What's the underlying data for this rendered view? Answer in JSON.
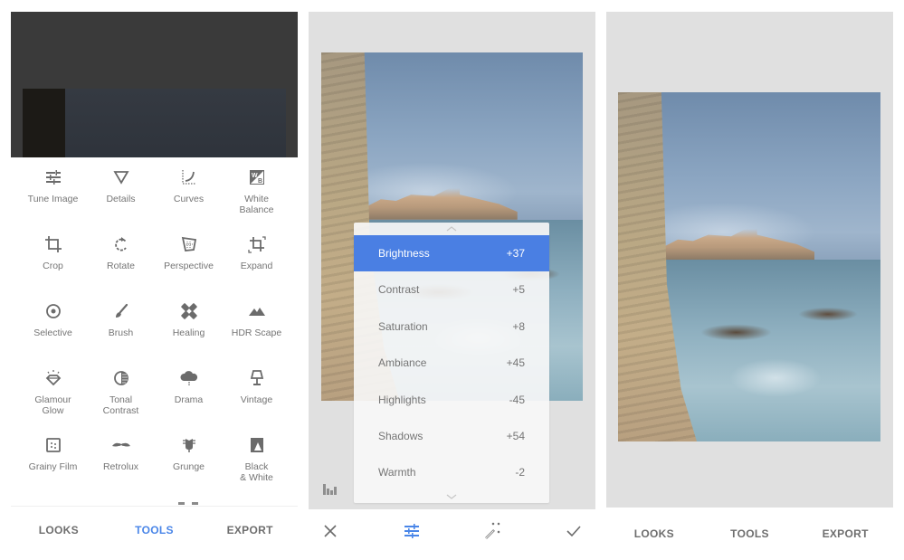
{
  "screen1": {
    "tools": [
      {
        "label": "Tune Image",
        "icon": "tune-icon"
      },
      {
        "label": "Details",
        "icon": "details-triangle-icon"
      },
      {
        "label": "Curves",
        "icon": "curves-icon"
      },
      {
        "label": "White\nBalance",
        "icon": "white-balance-icon"
      },
      {
        "label": "Crop",
        "icon": "crop-icon"
      },
      {
        "label": "Rotate",
        "icon": "rotate-icon"
      },
      {
        "label": "Perspective",
        "icon": "perspective-icon"
      },
      {
        "label": "Expand",
        "icon": "expand-icon"
      },
      {
        "label": "Selective",
        "icon": "selective-icon"
      },
      {
        "label": "Brush",
        "icon": "brush-icon"
      },
      {
        "label": "Healing",
        "icon": "healing-bandage-icon"
      },
      {
        "label": "HDR Scape",
        "icon": "mountains-icon"
      },
      {
        "label": "Glamour\nGlow",
        "icon": "diamond-glow-icon"
      },
      {
        "label": "Tonal\nContrast",
        "icon": "tonal-contrast-icon"
      },
      {
        "label": "Drama",
        "icon": "cloud-icon"
      },
      {
        "label": "Vintage",
        "icon": "lamp-icon"
      },
      {
        "label": "Grainy Film",
        "icon": "grainy-film-icon"
      },
      {
        "label": "Retrolux",
        "icon": "mustache-icon"
      },
      {
        "label": "Grunge",
        "icon": "guitar-icon"
      },
      {
        "label": "Black\n& White",
        "icon": "black-white-icon"
      }
    ],
    "nav": {
      "looks": "LOOKS",
      "tools": "TOOLS",
      "export": "EXPORT",
      "active": "TOOLS"
    }
  },
  "screen2": {
    "adjustments": [
      {
        "name": "Brightness",
        "value": "+37",
        "selected": true
      },
      {
        "name": "Contrast",
        "value": "+5",
        "selected": false
      },
      {
        "name": "Saturation",
        "value": "+8",
        "selected": false
      },
      {
        "name": "Ambiance",
        "value": "+45",
        "selected": false
      },
      {
        "name": "Highlights",
        "value": "-45",
        "selected": false
      },
      {
        "name": "Shadows",
        "value": "+54",
        "selected": false
      },
      {
        "name": "Warmth",
        "value": "-2",
        "selected": false
      }
    ],
    "toolbar": [
      "close-icon",
      "tune-icon",
      "auto-magic-wand-icon",
      "check-icon"
    ]
  },
  "screen3": {
    "nav": {
      "looks": "LOOKS",
      "tools": "TOOLS",
      "export": "EXPORT"
    }
  },
  "colors": {
    "accent": "#4a7fe3",
    "nav_active": "#4a86e8",
    "panel_bg": "#e0e0e0",
    "text": "#757575"
  }
}
